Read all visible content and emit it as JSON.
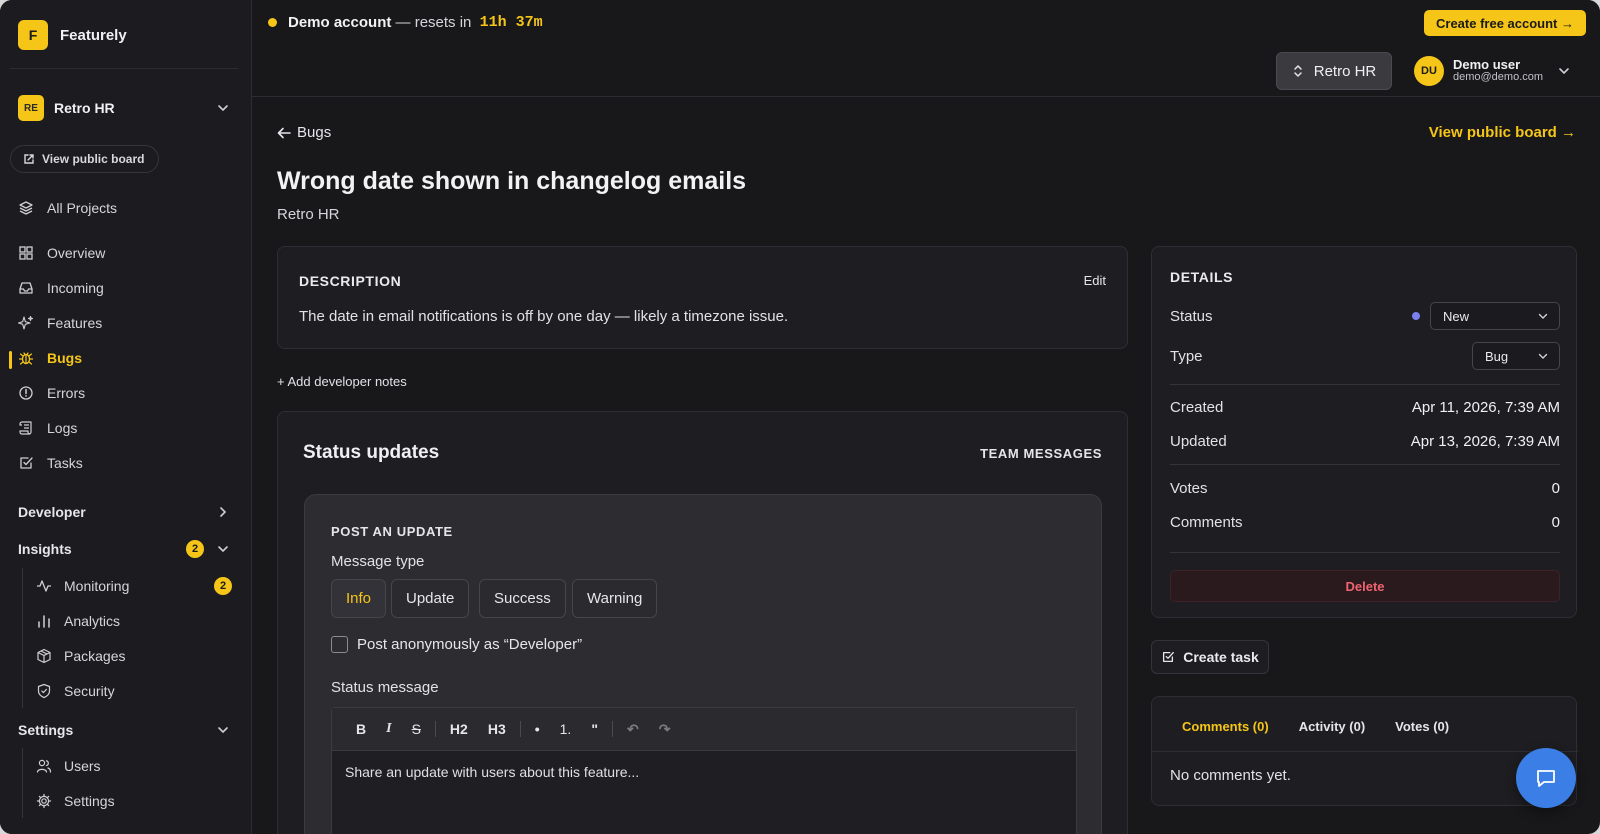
{
  "app": {
    "logo_letter": "F",
    "name": "Featurely"
  },
  "project": {
    "badge": "RE",
    "name": "Retro HR"
  },
  "sidebar": {
    "view_public_board": "View public board",
    "all_projects": "All Projects",
    "items": [
      {
        "label": "Overview",
        "icon": "grid-icon"
      },
      {
        "label": "Incoming",
        "icon": "inbox-icon"
      },
      {
        "label": "Features",
        "icon": "sparkles-icon"
      },
      {
        "label": "Bugs",
        "icon": "bug-icon"
      },
      {
        "label": "Errors",
        "icon": "alert-circle-icon"
      },
      {
        "label": "Logs",
        "icon": "scroll-icon"
      },
      {
        "label": "Tasks",
        "icon": "check-square-icon"
      }
    ],
    "developer": "Developer",
    "insights": {
      "label": "Insights",
      "count": "2"
    },
    "insights_items": [
      {
        "label": "Monitoring",
        "count": "2"
      },
      {
        "label": "Analytics"
      },
      {
        "label": "Packages"
      },
      {
        "label": "Security"
      }
    ],
    "settings": {
      "label": "Settings"
    },
    "settings_items": [
      {
        "label": "Users"
      },
      {
        "label": "Settings"
      }
    ]
  },
  "topbar": {
    "demo_label": "Demo account",
    "demo_sep": " — resets in ",
    "timer": "11h 37m",
    "cta": "Create free account →",
    "project_switch": "Retro HR",
    "user": {
      "initials": "DU",
      "name": "Demo user",
      "email": "demo@demo.com"
    }
  },
  "main": {
    "back_label": "Bugs",
    "view_public": "View public board →",
    "title": "Wrong date shown in changelog emails",
    "subtitle": "Retro HR",
    "description": {
      "heading": "DESCRIPTION",
      "edit": "Edit",
      "body": "The date in email notifications is off by one day — likely a timezone issue."
    },
    "add_notes": "+ Add developer notes",
    "status_updates": {
      "title": "Status updates",
      "team_messages": "TEAM MESSAGES",
      "post_heading": "POST AN UPDATE",
      "message_type_label": "Message type",
      "message_types": [
        "Info",
        "Update",
        "Success",
        "Warning"
      ],
      "selected_type": "Info",
      "anonymous_label": "Post anonymously as “Developer”",
      "status_message_label": "Status message",
      "toolbar": [
        "B",
        "I",
        "S",
        "H2",
        "H3",
        "•",
        "1.",
        "\"",
        "↶",
        "↷"
      ],
      "placeholder": "Share an update with users about this feature..."
    }
  },
  "details": {
    "heading": "DETAILS",
    "status_label": "Status",
    "status_value": "New",
    "type_label": "Type",
    "type_value": "Bug",
    "created_label": "Created",
    "created_value": "Apr 11, 2026, 7:39 AM",
    "updated_label": "Updated",
    "updated_value": "Apr 13, 2026, 7:39 AM",
    "votes_label": "Votes",
    "votes_value": "0",
    "comments_label": "Comments",
    "comments_value": "0",
    "delete": "Delete"
  },
  "create_task": "Create task",
  "comments_panel": {
    "tabs": [
      "Comments (0)",
      "Activity (0)",
      "Votes (0)"
    ],
    "empty": "No comments yet."
  },
  "colors": {
    "accent": "#f5c518",
    "background": "#18181b",
    "danger": "#f06470",
    "status_dot": "#7b7ff0",
    "chat": "#3b7ee6"
  }
}
